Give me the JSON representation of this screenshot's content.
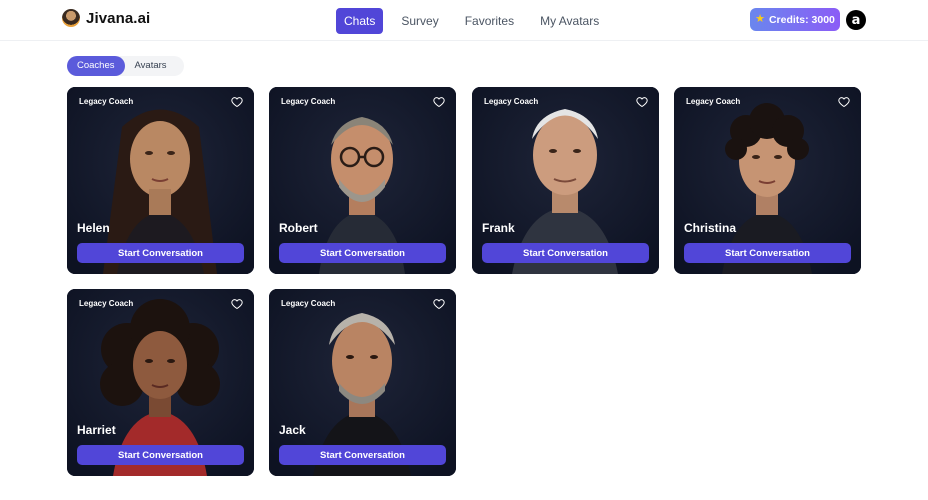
{
  "brand": {
    "name": "Jivana.ai",
    "logo_icon": "avatar-logo-icon"
  },
  "nav": {
    "items": [
      {
        "label": "Chats",
        "active": true
      },
      {
        "label": "Survey",
        "active": false
      },
      {
        "label": "Favorites",
        "active": false
      },
      {
        "label": "My Avatars",
        "active": false
      }
    ]
  },
  "credits": {
    "label": "Credits: 3000",
    "icon": "star-icon"
  },
  "user": {
    "avatar_letter": "a"
  },
  "tabs": [
    {
      "label": "Coaches",
      "active": true
    },
    {
      "label": "Avatars",
      "active": false
    }
  ],
  "cards": [
    {
      "label": "Legacy Coach",
      "name": "Helen",
      "button": "Start Conversation"
    },
    {
      "label": "Legacy Coach",
      "name": "Robert",
      "button": "Start Conversation"
    },
    {
      "label": "Legacy Coach",
      "name": "Frank",
      "button": "Start Conversation"
    },
    {
      "label": "Legacy Coach",
      "name": "Christina",
      "button": "Start Conversation"
    },
    {
      "label": "Legacy Coach",
      "name": "Harriet",
      "button": "Start Conversation"
    },
    {
      "label": "Legacy Coach",
      "name": "Jack",
      "button": "Start Conversation"
    }
  ],
  "colors": {
    "accent": "#5146d8",
    "card_bg": "#0f172a"
  }
}
